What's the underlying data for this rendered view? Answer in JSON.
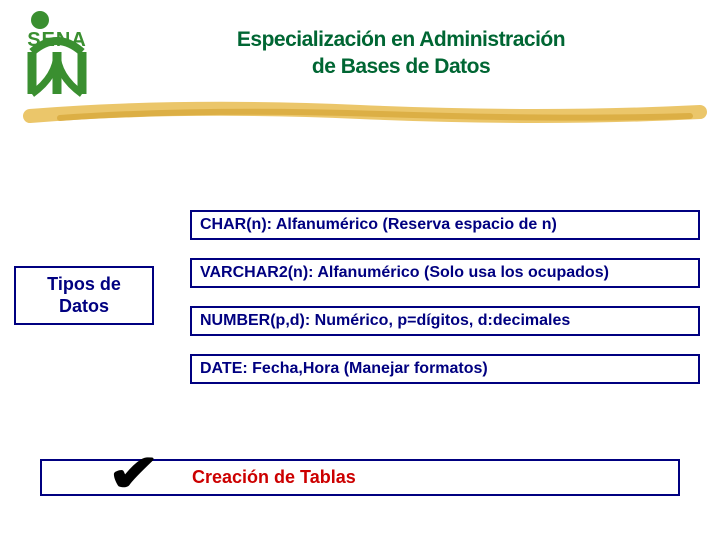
{
  "logo": {
    "text": "SENA",
    "color": "#3a8f30"
  },
  "header": {
    "title_line1": "Especialización en Administración",
    "title_line2": "de Bases de Datos"
  },
  "side_label": {
    "line1": "Tipos de",
    "line2": "Datos"
  },
  "datatypes": [
    {
      "text": "CHAR(n): Alfanumérico (Reserva espacio de n)"
    },
    {
      "text": "VARCHAR2(n): Alfanumérico (Solo usa los ocupados)"
    },
    {
      "text": "NUMBER(p,d): Numérico, p=dígitos, d:decimales"
    },
    {
      "text": "DATE: Fecha,Hora (Manejar formatos)"
    }
  ],
  "footer": {
    "label": "Creación de Tablas",
    "check": "✔"
  },
  "colors": {
    "brush": "#e0b040",
    "titleGreen": "#006633",
    "navy": "#000080",
    "red": "#cc0000"
  }
}
